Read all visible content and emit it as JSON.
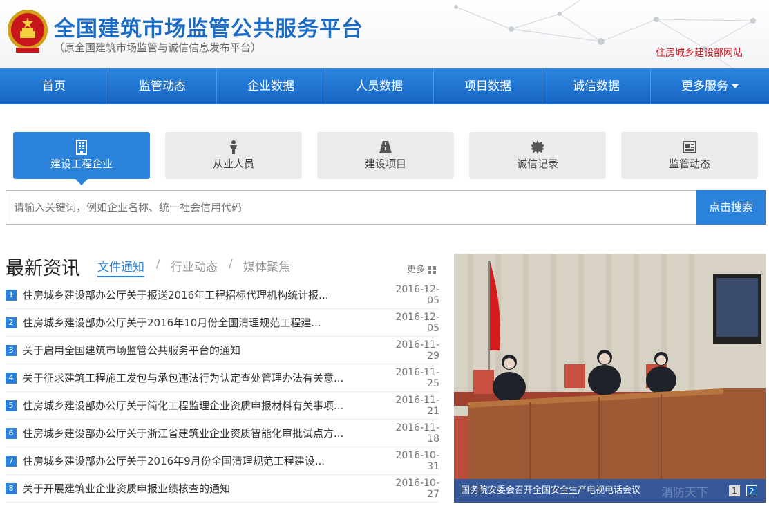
{
  "header": {
    "title": "全国建筑市场监管公共服务平台",
    "subtitle": "（原全国建筑市场监管与诚信信息发布平台）",
    "top_link": "住房城乡建设部网站"
  },
  "nav": {
    "items": [
      "首页",
      "监管动态",
      "企业数据",
      "人员数据",
      "项目数据",
      "诚信数据"
    ],
    "more": "更多服务"
  },
  "categories": [
    {
      "label": "建设工程企业",
      "icon": "building-icon",
      "active": true
    },
    {
      "label": "从业人员",
      "icon": "person-icon",
      "active": false
    },
    {
      "label": "建设项目",
      "icon": "road-icon",
      "active": false
    },
    {
      "label": "诚信记录",
      "icon": "gear-badge-icon",
      "active": false
    },
    {
      "label": "监管动态",
      "icon": "newspaper-icon",
      "active": false
    }
  ],
  "search": {
    "placeholder": "请输入关键词，例如企业名称、统一社会信用代码",
    "button": "点击搜索"
  },
  "news": {
    "title": "最新资讯",
    "tabs": [
      "文件通知",
      "行业动态",
      "媒体聚焦"
    ],
    "more": "更多",
    "items": [
      {
        "num": "1",
        "text": "住房城乡建设部办公厅关于报送2016年工程招标代理机构统计报...",
        "date": "2016-12-05"
      },
      {
        "num": "2",
        "text": "住房城乡建设部办公厅关于2016年10月份全国清理规范工程建...",
        "date": "2016-12-05"
      },
      {
        "num": "3",
        "text": "关于启用全国建筑市场监管公共服务平台的通知",
        "date": "2016-11-29"
      },
      {
        "num": "4",
        "text": "关于征求建筑工程施工发包与承包违法行为认定查处管理办法有关意...",
        "date": "2016-11-25"
      },
      {
        "num": "5",
        "text": "住房城乡建设部办公厅关于简化工程监理企业资质申报材料有关事项...",
        "date": "2016-11-21"
      },
      {
        "num": "6",
        "text": "住房城乡建设部办公厅关于浙江省建筑业企业资质智能化审批试点方...",
        "date": "2016-11-18"
      },
      {
        "num": "7",
        "text": "住房城乡建设部办公厅关于2016年9月份全国清理规范工程建设...",
        "date": "2016-10-31"
      },
      {
        "num": "8",
        "text": "关于开展建筑业企业资质申报业绩核查的通知",
        "date": "2016-10-27"
      }
    ]
  },
  "photo": {
    "caption": "国务院安委会召开全国安全生产电视电话会议",
    "pages": [
      "1",
      "2"
    ],
    "watermark": "消防天下"
  },
  "colors": {
    "brand": "#1c6bc4",
    "accent": "#2a82da",
    "link_red": "#c8161d"
  }
}
